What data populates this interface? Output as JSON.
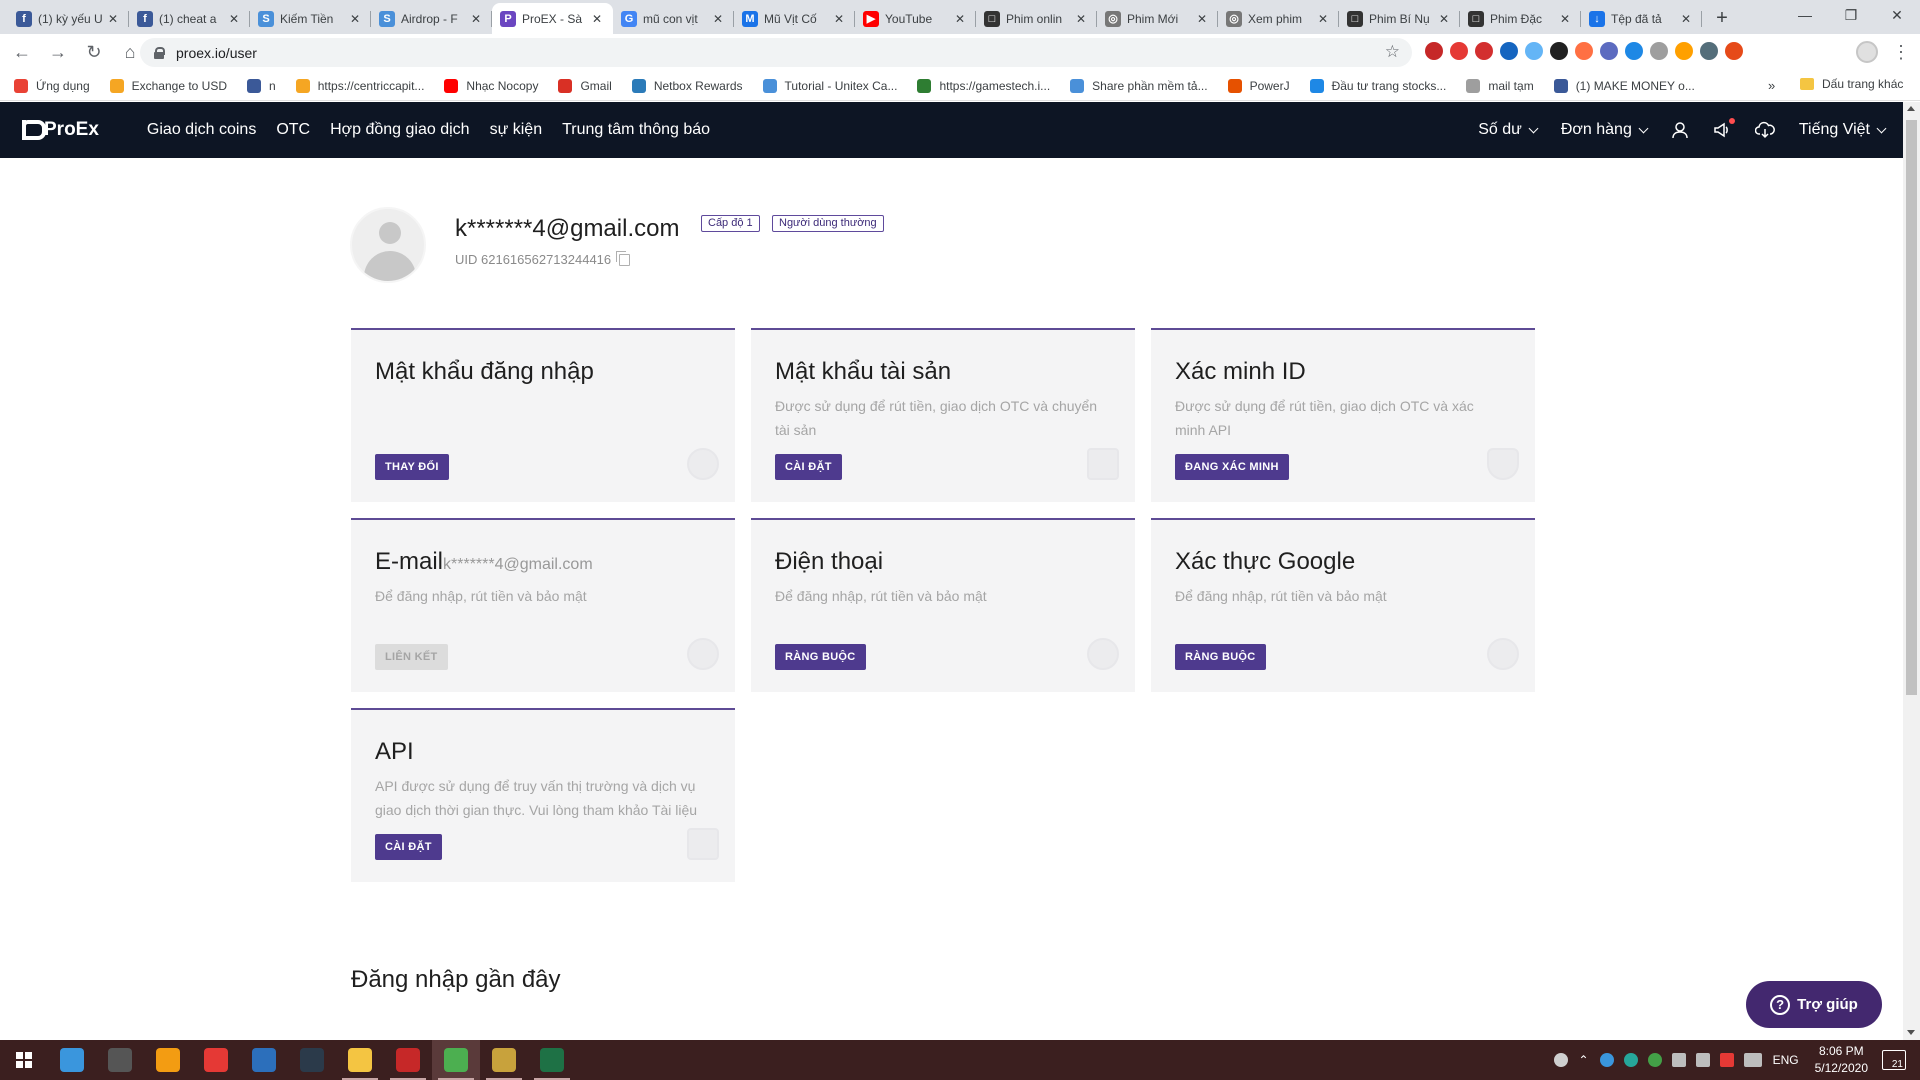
{
  "browser": {
    "tabs": [
      {
        "title": "(1) kỳ yếu U",
        "fav": "#3b5998",
        "glyph": "f"
      },
      {
        "title": "(1) cheat a",
        "fav": "#3b5998",
        "glyph": "f"
      },
      {
        "title": "Kiếm Tiền",
        "fav": "#4a90d9",
        "glyph": "S"
      },
      {
        "title": "Airdrop - F",
        "fav": "#4a90d9",
        "glyph": "S"
      },
      {
        "title": "ProEX - Sà",
        "fav": "#6b46c1",
        "glyph": "P",
        "active": true
      },
      {
        "title": "mũ con vịt",
        "fav": "#4285f4",
        "glyph": "G"
      },
      {
        "title": "Mũ Vịt Cố",
        "fav": "#1a73e8",
        "glyph": "M"
      },
      {
        "title": "YouTube",
        "fav": "#ff0000",
        "glyph": "▶"
      },
      {
        "title": "Phim onlin",
        "fav": "#333333",
        "glyph": "□"
      },
      {
        "title": "Phim Mới",
        "fav": "#777777",
        "glyph": "◎"
      },
      {
        "title": "Xem phim",
        "fav": "#777777",
        "glyph": "◎"
      },
      {
        "title": "Phim Bí Nụ",
        "fav": "#333333",
        "glyph": "□"
      },
      {
        "title": "Phim Đặc",
        "fav": "#333333",
        "glyph": "□"
      },
      {
        "title": "Tệp đã tả",
        "fav": "#1a73e8",
        "glyph": "↓"
      }
    ],
    "url": "proex.io/user",
    "bookmarks": [
      {
        "label": "Ứng dụng",
        "color": "#e94235"
      },
      {
        "label": "Exchange to USD",
        "color": "#f5a623"
      },
      {
        "label": "n",
        "color": "#3b5998"
      },
      {
        "label": "https://centriccapit...",
        "color": "#f5a623"
      },
      {
        "label": "Nhạc Nocopy",
        "color": "#ff0000"
      },
      {
        "label": "Gmail",
        "color": "#d93025"
      },
      {
        "label": "Netbox Rewards",
        "color": "#2b7bb9"
      },
      {
        "label": "Tutorial - Unitex Ca...",
        "color": "#4a90d9"
      },
      {
        "label": "https://gamestech.i...",
        "color": "#2e7d32"
      },
      {
        "label": "Share phần mềm tả...",
        "color": "#4a90d9"
      },
      {
        "label": "PowerJ",
        "color": "#e65100"
      },
      {
        "label": "Đầu tư trang stocks...",
        "color": "#1e88e5"
      },
      {
        "label": "mail tạm",
        "color": "#9e9e9e"
      },
      {
        "label": "(1) MAKE MONEY o...",
        "color": "#3b5998"
      }
    ],
    "bookmarks_more": "»",
    "bookmarks_other": "Dấu trang khác",
    "extension_colors": [
      "#c62828",
      "#e53935",
      "#d32f2f",
      "#1565c0",
      "#64b5f6",
      "#212121",
      "#ff7043",
      "#5c6bc0",
      "#1e88e5",
      "#9e9e9e",
      "#ffa000",
      "#546e7a",
      "#e64a19"
    ]
  },
  "site": {
    "logo": "ProEx",
    "nav": [
      "Giao dịch coins",
      "OTC",
      "Hợp đồng giao dịch",
      "sự kiện",
      "Trung tâm thông báo"
    ],
    "balance": "Số dư",
    "orders": "Đơn hàng",
    "language": "Tiếng Việt"
  },
  "profile": {
    "email": "k*******4@gmail.com",
    "level_badge": "Cấp độ 1",
    "user_badge": "Người dùng thường",
    "uid": "UID 621616562713244416"
  },
  "cards": {
    "login_password": {
      "title": "Mật khẩu đăng nhập",
      "button": "THAY ĐỔI"
    },
    "asset_password": {
      "title": "Mật khẩu tài sản",
      "desc": "Được sử dụng để rút tiền, giao dịch OTC và chuyển tài sản",
      "button": "CÀI ĐẶT"
    },
    "id_verify": {
      "title": "Xác minh ID",
      "desc": "Được sử dụng để rút tiền, giao dịch OTC và xác minh API",
      "button": "ĐANG XÁC MINH"
    },
    "email": {
      "title": "E-mail",
      "sub": "k*******4@gmail.com",
      "desc": "Để đăng nhập, rút tiền và bảo mật",
      "button": "LIÊN KẾT"
    },
    "phone": {
      "title": "Điện thoại",
      "desc": "Để đăng nhập, rút tiền và bảo mật",
      "button": "RÀNG BUỘC"
    },
    "google_auth": {
      "title": "Xác thực Google",
      "desc": "Để đăng nhập, rút tiền và bảo mật",
      "button": "RÀNG BUỘC"
    },
    "api": {
      "title": "API",
      "desc": "API được sử dụng để truy vấn thị trường và dịch vụ giao dịch thời gian thực. Vui lòng tham khảo Tài liệu",
      "button": "CÀI ĐẶT"
    }
  },
  "recent_login_title": "Đăng nhập gần đây",
  "help_button": "Trợ giúp",
  "help_glyph": "?",
  "taskbar": {
    "apps": [
      {
        "name": "cortana",
        "color": "#3a96dd"
      },
      {
        "name": "camera",
        "color": "#555555"
      },
      {
        "name": "sublime",
        "color": "#f39c12"
      },
      {
        "name": "yandex",
        "color": "#e53935"
      },
      {
        "name": "notepad",
        "color": "#2c6fbb"
      },
      {
        "name": "lightroom",
        "color": "#2b3a4a"
      },
      {
        "name": "explorer",
        "color": "#f4c542"
      },
      {
        "name": "media",
        "color": "#c62828"
      },
      {
        "name": "chrome",
        "color": "#4caf50"
      },
      {
        "name": "league",
        "color": "#c8a23c"
      },
      {
        "name": "excel",
        "color": "#1e7145"
      }
    ],
    "lang": "ENG",
    "time": "8:06 PM",
    "date": "5/12/2020",
    "notifications": "21"
  },
  "colors": {
    "nav_bg": "#0d1524",
    "accent": "#4e3a8e",
    "card_bg": "#f4f4f5",
    "help_bg": "#43286f"
  }
}
